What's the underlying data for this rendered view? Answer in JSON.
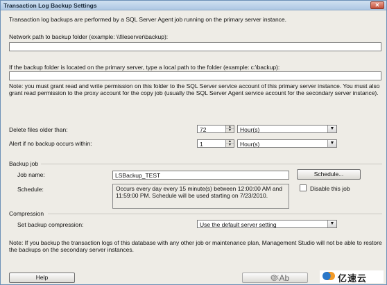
{
  "window": {
    "title": "Transaction Log Backup Settings",
    "close_glyph": "✕"
  },
  "intro_text": "Transaction log backups are performed by a SQL Server Agent job running on the primary server instance.",
  "network_path": {
    "label": "Network path to backup folder (example: \\\\fileserver\\backup):",
    "value": ""
  },
  "local_path": {
    "label": "If the backup folder is located on the primary server, type a local path to the folder (example: c:\\backup):",
    "value": ""
  },
  "permission_note": "Note: you must grant read and write permission on this folder to the SQL Server service account of this primary server instance. You must also grant read permission to the proxy account for the copy job (usually the SQL Server Agent service account for the secondary server instance).",
  "delete_files": {
    "label": "Delete files older than:",
    "value": "72",
    "unit": "Hour(s)"
  },
  "alert": {
    "label": "Alert if no backup occurs within:",
    "value": "1",
    "unit": "Hour(s)"
  },
  "backup_job": {
    "section_label": "Backup job",
    "job_name_label": "Job name:",
    "job_name_value": "LSBackup_TEST",
    "schedule_button": "Schedule...",
    "schedule_label": "Schedule:",
    "schedule_text": "Occurs every day every 15 minute(s) between 12:00:00 AM and 11:59:00 PM. Schedule will be used starting on 7/23/2010.",
    "disable_label": "Disable this job"
  },
  "compression": {
    "section_label": "Compression",
    "set_label": "Set backup compression:",
    "value": "Use the default server setting"
  },
  "bottom_note": "Note: If you backup the transaction logs of this database with any other job or maintenance plan, Management Studio will not be able to restore the backups on the secondary server instances.",
  "buttons": {
    "help": "Help",
    "ok": "OK"
  },
  "watermark": {
    "partial": "© Ab",
    "logo_text": "亿速云"
  },
  "icons": {
    "dropdown": "▼",
    "spin_up": "▲",
    "spin_down": "▼"
  }
}
